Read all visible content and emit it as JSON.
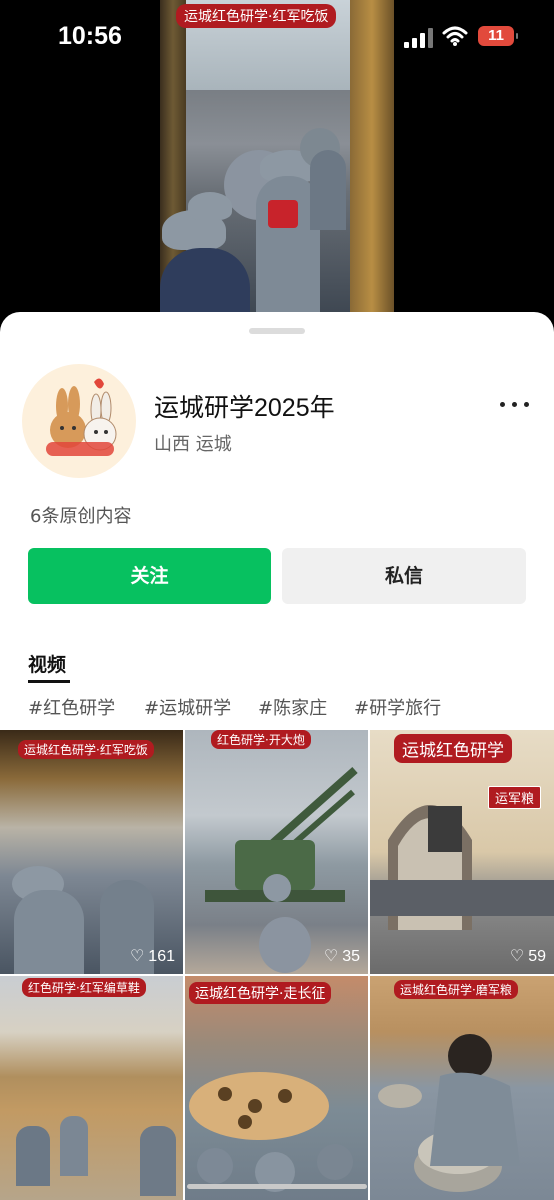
{
  "status_bar": {
    "time": "10:56",
    "battery": "11"
  },
  "hero": {
    "overlay_title": "运城红色研学·红军吃饭"
  },
  "profile": {
    "name": "运城研学2025年",
    "location": "山西 运城",
    "content_count": "6条原创内容"
  },
  "actions": {
    "follow": "关注",
    "message": "私信"
  },
  "tabs": {
    "videos": "视频"
  },
  "tags": [
    "#红色研学",
    "#运城研学",
    "#陈家庄",
    "#研学旅行"
  ],
  "videos": [
    {
      "title": "运城红色研学·红军吃饭",
      "likes": "161"
    },
    {
      "title": "红色研学·开大炮",
      "likes": "35"
    },
    {
      "title": "运城红色研学",
      "badge": "运军粮",
      "likes": "59"
    },
    {
      "title": "红色研学·红军编草鞋",
      "likes": ""
    },
    {
      "title": "运城红色研学·走长征",
      "likes": ""
    },
    {
      "title": "运城红色研学·磨军粮",
      "likes": ""
    }
  ],
  "icons": {
    "signal": "signal-icon",
    "wifi": "wifi-icon",
    "battery": "battery-icon",
    "more": "more-icon",
    "heart": "heart-icon"
  },
  "colors": {
    "follow_button": "#07c160",
    "label_red": "#b01b20"
  }
}
